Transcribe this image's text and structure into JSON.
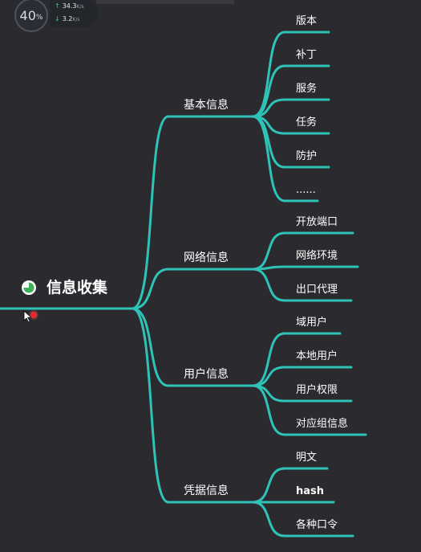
{
  "monitor": {
    "cpu_percent": "40",
    "cpu_unit": "%",
    "upload_speed": "34.3",
    "download_speed": "3.2",
    "speed_unit": "K/s"
  },
  "root": {
    "label": "信息收集",
    "icon": "pie-progress-icon"
  },
  "colors": {
    "background": "#2b2a2f",
    "line": "#2fc3b8",
    "text": "#ffffff",
    "icon": "#3fb05a"
  },
  "branches": [
    {
      "label": "基本信息",
      "leaves": [
        "版本",
        "补丁",
        "服务",
        "任务",
        "防护",
        "......"
      ]
    },
    {
      "label": "网络信息",
      "leaves": [
        "开放端口",
        "网络环境",
        "出口代理"
      ]
    },
    {
      "label": "用户信息",
      "leaves": [
        "域用户",
        "本地用户",
        "用户权限",
        "对应组信息"
      ]
    },
    {
      "label": "凭据信息",
      "leaves": [
        "明文",
        "hash",
        "各种口令"
      ]
    }
  ]
}
